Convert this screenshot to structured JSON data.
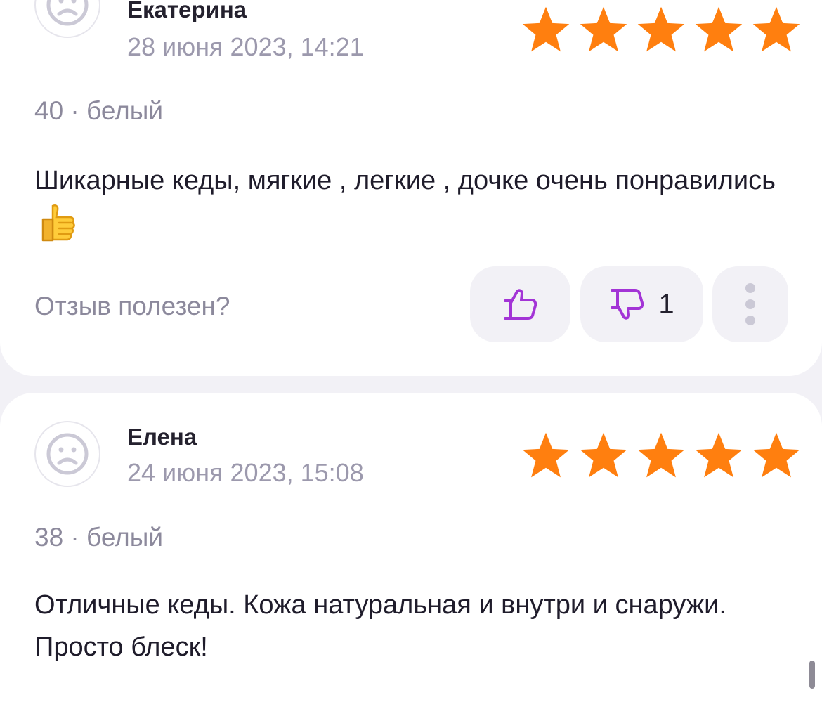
{
  "reviews": [
    {
      "author": "Екатерина",
      "date": "28 июня 2023, 14:21",
      "rating": 5,
      "variant": "40 · белый",
      "text": "Шикарные кеды, мягкие , легкие , дочке очень понравились",
      "emoji": "thumbs-up-emoji",
      "helpful_label": "Отзыв полезен?",
      "dislike_count": "1"
    },
    {
      "author": "Елена",
      "date": "24 июня 2023, 15:08",
      "rating": 5,
      "variant": "38 · белый",
      "text": "Отличные кеды. Кожа натуральная и внутри и снаружи. Просто блеск!"
    }
  ],
  "colors": {
    "star": "#ff7f0f",
    "accent_purple": "#a334d6",
    "background": "#f2f1f6",
    "card": "#ffffff",
    "muted_text": "#8c899c"
  },
  "icons": {
    "avatar": "sad-face-avatar-icon",
    "like": "thumbs-up-outline-icon",
    "dislike": "thumbs-down-outline-icon",
    "more": "vertical-dots-icon",
    "star": "star-icon"
  }
}
